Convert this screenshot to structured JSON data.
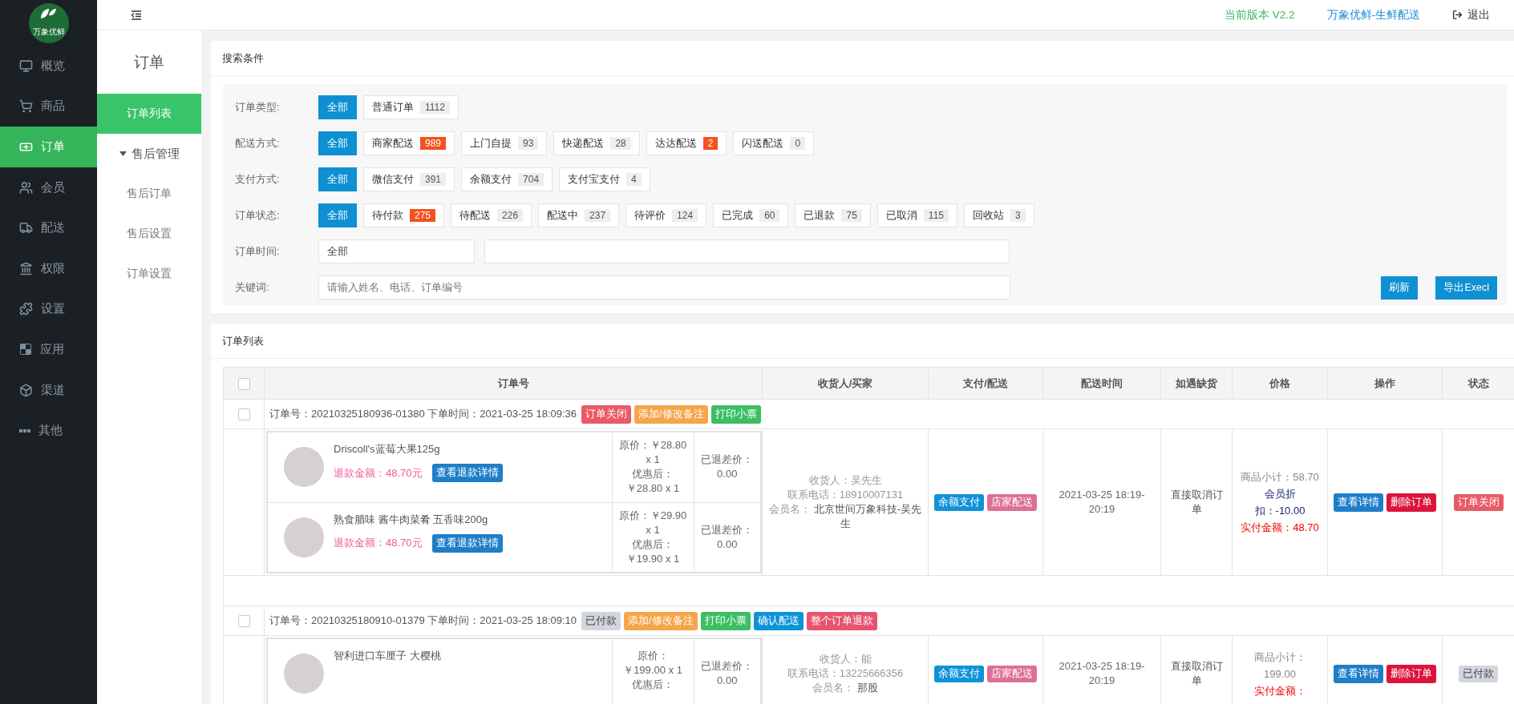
{
  "logo": {
    "text": "万象优鲜"
  },
  "sidebar": {
    "items": [
      {
        "label": "概览",
        "selected": false
      },
      {
        "label": "商品",
        "selected": false
      },
      {
        "label": "订单",
        "selected": true
      },
      {
        "label": "会员",
        "selected": false
      },
      {
        "label": "配送",
        "selected": false
      },
      {
        "label": "权限",
        "selected": false
      },
      {
        "label": "设置",
        "selected": false
      },
      {
        "label": "应用",
        "selected": false
      },
      {
        "label": "渠道",
        "selected": false
      },
      {
        "label": "其他",
        "selected": false
      }
    ]
  },
  "subnav": {
    "title": "订单",
    "items": [
      {
        "label": "订单列表",
        "kind": "link",
        "selected": true
      },
      {
        "label": "售后管理",
        "kind": "group",
        "expanded": true,
        "children": [
          {
            "label": "售后订单",
            "selected": false
          },
          {
            "label": "售后设置",
            "selected": false
          },
          {
            "label": "订单设置",
            "selected": false
          }
        ]
      }
    ]
  },
  "header": {
    "version": "当前版本 V2.2",
    "brand": "万象优鲜-生鲜配送",
    "logout": "退出"
  },
  "search": {
    "title": "搜索条件",
    "filters": [
      {
        "label": "订单类型:",
        "options": [
          {
            "label": "全部",
            "selected": true
          },
          {
            "label": "普通订单",
            "count": "1112",
            "hot": false,
            "selected": false
          }
        ]
      },
      {
        "label": "配送方式:",
        "options": [
          {
            "label": "全部",
            "selected": true
          },
          {
            "label": "商家配送",
            "count": "989",
            "hot": true,
            "selected": false
          },
          {
            "label": "上门自提",
            "count": "93",
            "hot": false,
            "selected": false
          },
          {
            "label": "快递配送",
            "count": "28",
            "hot": false,
            "selected": false
          },
          {
            "label": "达达配送",
            "count": "2",
            "hot": true,
            "selected": false
          },
          {
            "label": "闪送配送",
            "count": "0",
            "hot": false,
            "selected": false
          }
        ]
      },
      {
        "label": "支付方式:",
        "options": [
          {
            "label": "全部",
            "selected": true
          },
          {
            "label": "微信支付",
            "count": "391",
            "hot": false,
            "selected": false
          },
          {
            "label": "余额支付",
            "count": "704",
            "hot": false,
            "selected": false
          },
          {
            "label": "支付宝支付",
            "count": "4",
            "hot": false,
            "selected": false
          }
        ]
      },
      {
        "label": "订单状态:",
        "options": [
          {
            "label": "全部",
            "selected": true
          },
          {
            "label": "待付款",
            "count": "275",
            "hot": true,
            "selected": false
          },
          {
            "label": "待配送",
            "count": "226",
            "hot": false,
            "selected": false
          },
          {
            "label": "配送中",
            "count": "237",
            "hot": false,
            "selected": false
          },
          {
            "label": "待评价",
            "count": "124",
            "hot": false,
            "selected": false
          },
          {
            "label": "已完成",
            "count": "60",
            "hot": false,
            "selected": false
          },
          {
            "label": "已退款",
            "count": "75",
            "hot": false,
            "selected": false
          },
          {
            "label": "已取消",
            "count": "115",
            "hot": false,
            "selected": false
          },
          {
            "label": "回收站",
            "count": "3",
            "hot": false,
            "selected": false
          }
        ]
      }
    ],
    "time": {
      "label": "订单时间:",
      "value": "全部"
    },
    "keyword": {
      "label": "关键词:",
      "placeholder": "请输入姓名、电话、订单编号"
    },
    "buttons": [
      "刷新",
      "导出Execl"
    ]
  },
  "list": {
    "title": "订单列表",
    "select_all": {
      "checked": false
    },
    "columns": [
      "订单号",
      "收货人/买家",
      "支付/配送",
      "配送时间",
      "如遇缺货",
      "价格",
      "操作",
      "状态"
    ],
    "orders": [
      {
        "checked": false,
        "info": "订单号：20210325180936-01380 下单时间：2021-03-25 18:09:36",
        "tags": [
          {
            "label": "订单关闭",
            "kind": "closed"
          },
          {
            "label": "添加/修改备注",
            "kind": "note"
          },
          {
            "label": "打印小票",
            "kind": "print"
          }
        ],
        "items": [
          {
            "name": "Driscoll's蓝莓大果125g",
            "refund": "退款金额：48.70元",
            "refund_button": "查看退款详情",
            "price_lines": [
              "原价：￥28.80",
              "x 1",
              "优惠后：",
              "￥28.80 x 1"
            ],
            "diff_lines": [
              "已退差价：",
              "0.00"
            ]
          },
          {
            "name": "熟食腊味 酱牛肉菜肴 五香味200g",
            "refund": "退款金额：48.70元",
            "refund_button": "查看退款详情",
            "price_lines": [
              "原价：￥29.90",
              "x 1",
              "优惠后：",
              "￥19.90 x 1"
            ],
            "diff_lines": [
              "已退差价：",
              "0.00"
            ]
          }
        ],
        "receiver": [
          "收货人：吴先生",
          "联系电话：18910007131"
        ],
        "member": {
          "label": "会员名：",
          "value": "北京世间万象科技-吴先生"
        },
        "pay_tags": [
          {
            "label": "余额支付",
            "kind": "pay"
          },
          {
            "label": "店家配送",
            "kind": "delivery"
          }
        ],
        "delivery_time": "2021-03-25 18:19-20:19",
        "shortage": "直接取消订单",
        "price": [
          {
            "text": "商品小计：58.70",
            "kind": "subtotal"
          },
          {
            "text": "会员折",
            "kind": "discount"
          },
          {
            "text": "扣：-10.00",
            "kind": "discount"
          },
          {
            "text": "实付金额：48.70",
            "kind": "paid"
          }
        ],
        "actions": [
          {
            "label": "查看详情",
            "kind": "detail"
          },
          {
            "label": "删除订单",
            "kind": "delete"
          }
        ],
        "status": {
          "label": "订单关闭",
          "kind": "closed"
        }
      },
      {
        "checked": false,
        "info": "订单号：20210325180910-01379 下单时间：2021-03-25 18:09:10",
        "tags": [
          {
            "label": "已付款",
            "kind": "paid"
          },
          {
            "label": "添加/修改备注",
            "kind": "note"
          },
          {
            "label": "打印小票",
            "kind": "print"
          },
          {
            "label": "确认配送",
            "kind": "confirm"
          },
          {
            "label": "整个订单退款",
            "kind": "refund"
          }
        ],
        "items": [
          {
            "name": "智利进口车厘子 大樱桃",
            "price_lines": [
              "原价：",
              "￥199.00 x 1",
              "优惠后："
            ],
            "diff_lines": [
              "已退差价：",
              "0.00"
            ]
          }
        ],
        "receiver": [
          "收货人：能",
          "联系电话：13225666356"
        ],
        "member": {
          "label": "会员名：",
          "value": "那股"
        },
        "pay_tags": [
          {
            "label": "余额支付",
            "kind": "pay"
          },
          {
            "label": "店家配送",
            "kind": "delivery"
          }
        ],
        "delivery_time": "2021-03-25 18:19-20:19",
        "shortage": "直接取消订单",
        "price": [
          {
            "text": "商品小计：",
            "kind": "subtotal"
          },
          {
            "text": "199.00",
            "kind": "subtotal"
          },
          {
            "text": "实付金额：",
            "kind": "paid"
          }
        ],
        "actions": [
          {
            "label": "查看详情",
            "kind": "detail"
          },
          {
            "label": "删除订单",
            "kind": "delete"
          }
        ],
        "status": {
          "label": "已付款",
          "kind": "paid"
        }
      }
    ]
  }
}
